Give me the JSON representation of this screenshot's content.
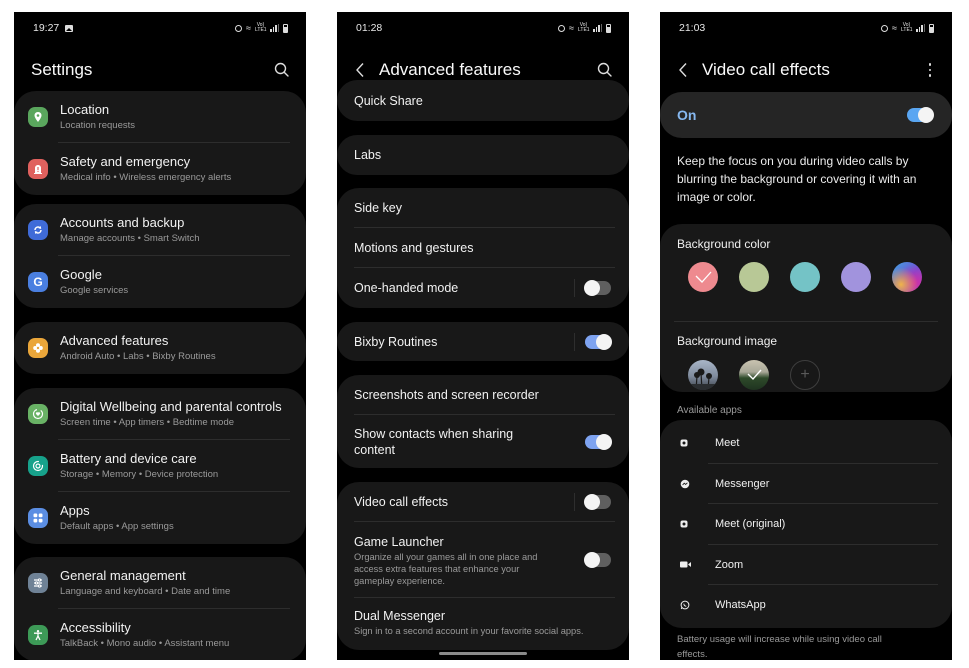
{
  "colors": {
    "background": "#000000",
    "card": "#181818",
    "toggle_on": "#7ea3f0",
    "toggle_off": "#5f5f5f",
    "accent_on_label": "#86b8f0"
  },
  "screens": {
    "settings": {
      "status_time": "19:27",
      "title": "Settings",
      "search_icon": "search-icon",
      "groups": [
        {
          "items": [
            {
              "icon": "location-icon",
              "color": "#5aa65d",
              "title": "Location",
              "subtitle": "Location requests"
            },
            {
              "icon": "safety-icon",
              "color": "#e0615e",
              "title": "Safety and emergency",
              "subtitle": "Medical info  •  Wireless emergency alerts"
            }
          ]
        },
        {
          "items": [
            {
              "icon": "sync-icon",
              "color": "#3f6bd8",
              "title": "Accounts and backup",
              "subtitle": "Manage accounts  •  Smart Switch"
            },
            {
              "icon": "google-icon",
              "color": "#4a7fe0",
              "title": "Google",
              "subtitle": "Google services"
            }
          ]
        },
        {
          "items": [
            {
              "icon": "gear-flower-icon",
              "color": "#eaa63a",
              "title": "Advanced features",
              "subtitle": "Android Auto  •  Labs  •  Bixby Routines"
            }
          ]
        },
        {
          "items": [
            {
              "icon": "wellbeing-icon",
              "color": "#69b265",
              "title": "Digital Wellbeing and parental controls",
              "subtitle": "Screen time  •  App timers  •  Bedtime mode"
            },
            {
              "icon": "device-care-icon",
              "color": "#17a28b",
              "title": "Battery and device care",
              "subtitle": "Storage  •  Memory  •  Device protection"
            },
            {
              "icon": "apps-grid-icon",
              "color": "#5b8ee3",
              "title": "Apps",
              "subtitle": "Default apps  •  App settings"
            }
          ]
        },
        {
          "items": [
            {
              "icon": "sliders-icon",
              "color": "#6f8296",
              "title": "General management",
              "subtitle": "Language and keyboard  •  Date and time"
            },
            {
              "icon": "accessibility-icon",
              "color": "#3d9a57",
              "title": "Accessibility",
              "subtitle": "TalkBack  •  Mono audio  •  Assistant menu"
            }
          ]
        }
      ]
    },
    "advanced": {
      "status_time": "01:28",
      "title": "Advanced features",
      "items": {
        "quick_share": {
          "title": "Quick Share"
        },
        "labs": {
          "title": "Labs"
        },
        "side_key": {
          "title": "Side key"
        },
        "motions": {
          "title": "Motions and gestures"
        },
        "one_handed": {
          "title": "One-handed mode",
          "toggle": "off"
        },
        "bixby": {
          "title": "Bixby Routines",
          "toggle": "on"
        },
        "screenshots": {
          "title": "Screenshots and screen recorder"
        },
        "show_contacts": {
          "title": "Show contacts when sharing content",
          "toggle": "on"
        },
        "video_call": {
          "title": "Video call effects",
          "toggle": "off"
        },
        "game_launcher": {
          "title": "Game Launcher",
          "subtitle": "Organize all your games all in one place and access extra features that enhance your gameplay experience.",
          "toggle": "off"
        },
        "dual_messenger": {
          "title": "Dual Messenger",
          "subtitle": "Sign in to a second account in your favorite social apps."
        }
      }
    },
    "video": {
      "status_time": "21:03",
      "title": "Video call effects",
      "master": {
        "label": "On",
        "toggle": "on"
      },
      "description": "Keep the focus on you during video calls by blurring the background or covering it with an image or color.",
      "background_color_label": "Background color",
      "background_colors": [
        {
          "name": "pink",
          "hex": "#ee8a8f",
          "selected": true
        },
        {
          "name": "sage",
          "hex": "#b8c896",
          "selected": false
        },
        {
          "name": "teal",
          "hex": "#74c3c6",
          "selected": false
        },
        {
          "name": "lavender",
          "hex": "#a193dd",
          "selected": false
        },
        {
          "name": "gradient",
          "hex": "gradient",
          "selected": false
        }
      ],
      "background_image_label": "Background image",
      "background_images": [
        {
          "name": "palm-trees",
          "selected": false
        },
        {
          "name": "landscape",
          "selected": true
        }
      ],
      "add_image_label": "+",
      "available_apps_label": "Available apps",
      "apps": [
        {
          "icon": "meet-icon",
          "name": "Meet"
        },
        {
          "icon": "messenger-icon",
          "name": "Messenger"
        },
        {
          "icon": "meet-original-icon",
          "name": "Meet (original)"
        },
        {
          "icon": "zoom-icon",
          "name": "Zoom"
        },
        {
          "icon": "whatsapp-icon",
          "name": "WhatsApp"
        }
      ],
      "footnote": "Battery usage will increase while using video call effects."
    }
  }
}
